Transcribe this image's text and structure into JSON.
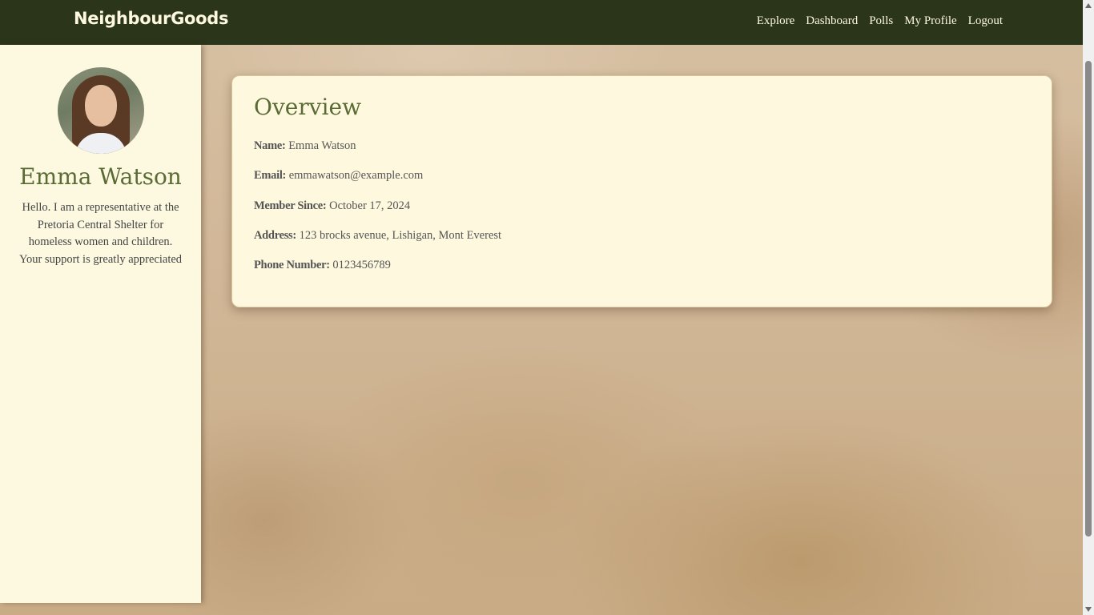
{
  "header": {
    "brand": "NeighbourGoods",
    "nav": [
      {
        "label": "Explore"
      },
      {
        "label": "Dashboard"
      },
      {
        "label": "Polls"
      },
      {
        "label": "My Profile"
      },
      {
        "label": "Logout"
      }
    ]
  },
  "sidebar": {
    "avatar_icon": "profile-photo",
    "name": "Emma Watson",
    "bio": "Hello. I am a representative at the Pretoria Central Shelter for homeless women and children. Your support is greatly appreciated"
  },
  "overview": {
    "title": "Overview",
    "fields": [
      {
        "label": "Name:",
        "value": "Emma Watson"
      },
      {
        "label": "Email:",
        "value": "emmawatson@example.com"
      },
      {
        "label": "Member Since:",
        "value": "October 17, 2024"
      },
      {
        "label": "Address:",
        "value": "123 brocks avenue, Lishigan, Mont Everest"
      },
      {
        "label": "Phone Number:",
        "value": "0123456789"
      }
    ]
  },
  "colors": {
    "topbar": "#2b3519",
    "accent_green": "#5b6b35",
    "cream": "#fdf8de"
  }
}
